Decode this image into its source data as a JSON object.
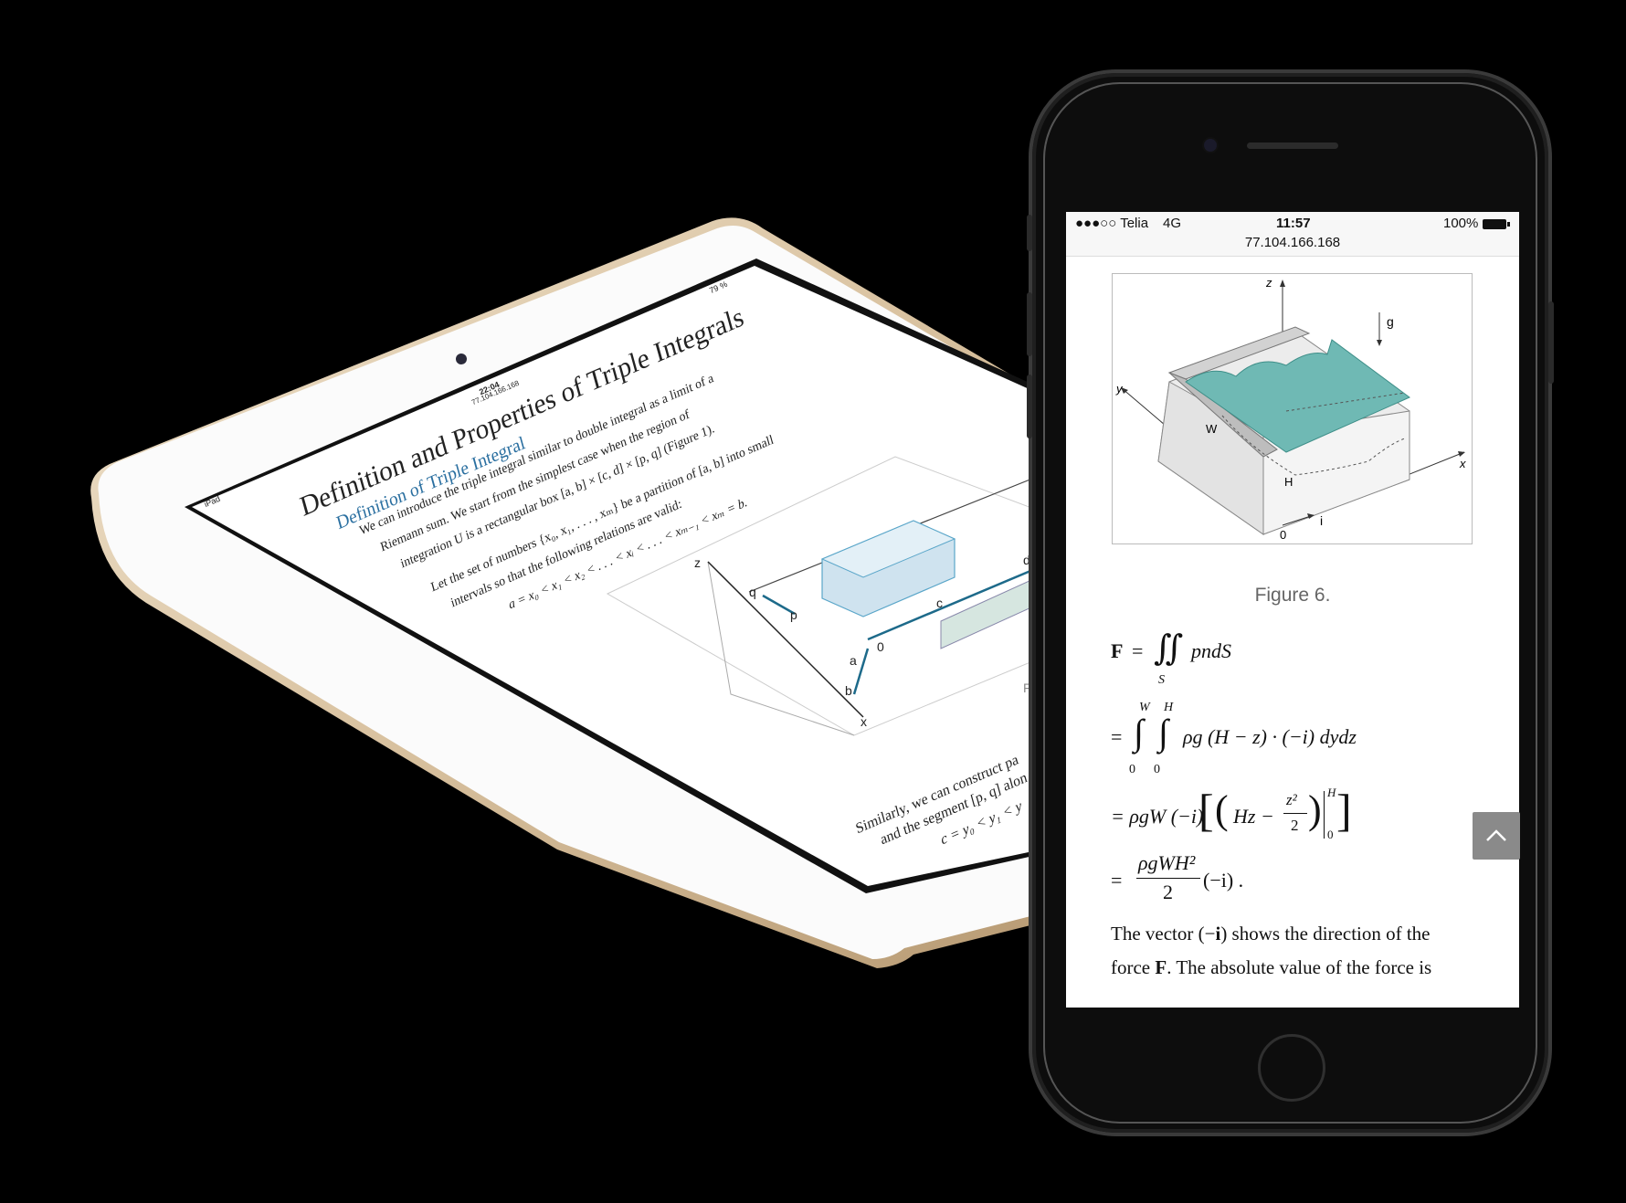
{
  "ipad": {
    "status_left": "iPad",
    "status_time": "22:04",
    "status_url": "77.104.166.168",
    "status_battery": "79 %",
    "title": "Definition and Properties of Triple Integrals",
    "subtitle": "Definition of Triple Integral",
    "lines": [
      "We can introduce the triple integral similar to double integral as a limit of a",
      "Riemann sum. We start from the simplest case when the region of",
      "integration U is a rectangular box [a, b] × [c, d] × [p, q] (Figure 1).",
      "Let the set of numbers {x₀, x₁, . . . , xₘ} be a partition of [a, b] into small",
      "intervals so that the following relations are valid:",
      "a = x₀ < x₁ < x₂ < . . . < xᵢ < . . . < xₘ₋₁ < xₘ = b."
    ],
    "bottom_lines": [
      "Similarly, we can construct pa",
      "and the segment [p, q] alon",
      "c = y₀ < y₁ < y"
    ],
    "figure_labels": {
      "z": "z",
      "q": "q",
      "p": "p",
      "c": "c",
      "d": "d",
      "a": "a",
      "b": "b",
      "o": "0",
      "x": "x",
      "fig": "Fi"
    }
  },
  "iphone": {
    "status": {
      "carrier": "●●●○○ Telia",
      "network": "4G",
      "time": "11:57",
      "battery": "100%",
      "url": "77.104.166.168"
    },
    "figure": {
      "labels": {
        "z": "z",
        "g": "g",
        "y": "y",
        "w": "W",
        "h": "H",
        "x": "x",
        "zero": "0",
        "i": "i"
      },
      "caption": "Figure 6."
    },
    "equations": {
      "line1_lhs": "F",
      "line1_rhs": "pndS",
      "line1_sub": "S",
      "line2_rhs": "ρg (H − z) · (−i) dydz",
      "line2_upper1": "W",
      "line2_upper2": "H",
      "line2_lower1": "0",
      "line2_lower2": "0",
      "line3_prefix": "= ρgW (−i)",
      "line3_inner": "Hz −",
      "line3_num": "z²",
      "line3_den": "2",
      "line3_upper": "H",
      "line3_lower": "0",
      "line4_num": "ρgWH²",
      "line4_den": "2",
      "line4_tail": "(−i) ."
    },
    "paragraph": {
      "l1_a": "The vector (−",
      "l1_b": "i",
      "l1_c": ") shows the direction of the",
      "l2_a": "force ",
      "l2_b": "F",
      "l2_c": ". The absolute value of the force is"
    },
    "scroll_top_icon": "chevron-up-icon"
  }
}
